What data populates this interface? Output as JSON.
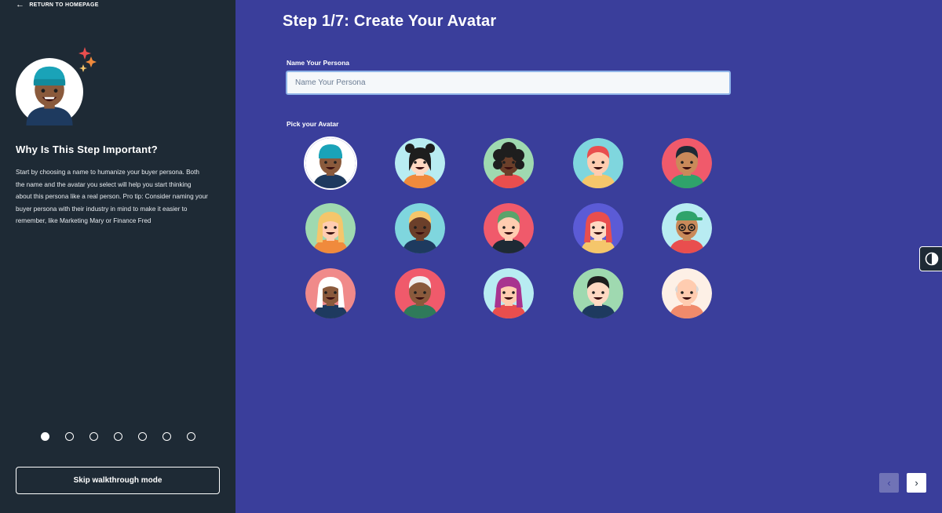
{
  "sidebar": {
    "return_label": "RETURN TO HOMEPAGE",
    "return_icon": "arrow-left-icon",
    "title": "Why Is This Step Important?",
    "description": "Start by choosing a name to humanize your buyer persona. Both the name and the avatar you select will help you start thinking about this persona like a real person. Pro tip: Consider naming your buyer persona with their industry in mind to make it easier to remember, like Marketing Mary or Finance Fred",
    "progress": {
      "current_step": 1,
      "total_steps": 7
    },
    "skip_label": "Skip walkthrough mode"
  },
  "main": {
    "step_title": "Step 1/7: Create Your Avatar",
    "name_label": "Name Your Persona",
    "name_placeholder": "Name Your Persona",
    "name_value": "",
    "pick_label": "Pick your Avatar",
    "selected_avatar": 1,
    "avatars": [
      {
        "id": 1,
        "bg": "#ffffff",
        "skin": "#8a5a3c",
        "hair": "#1aa3b8",
        "shirt": "#1e3a5f",
        "style": "beanie"
      },
      {
        "id": 2,
        "bg": "#b8ecf2",
        "skin": "#ffd9c2",
        "hair": "#1e1e1e",
        "shirt": "#f08a3c",
        "style": "buns"
      },
      {
        "id": 3,
        "bg": "#9fd9b0",
        "skin": "#6b3f2a",
        "hair": "#1e1e1e",
        "shirt": "#e94e4e",
        "style": "curly"
      },
      {
        "id": 4,
        "bg": "#7fd6de",
        "skin": "#ffccb0",
        "hair": "#e94e4e",
        "shirt": "#f5c66b",
        "style": "short"
      },
      {
        "id": 5,
        "bg": "#f05a6b",
        "skin": "#c98a5a",
        "hair": "#1e2a35",
        "shirt": "#2fa36b",
        "style": "short"
      },
      {
        "id": 6,
        "bg": "#9fd9b0",
        "skin": "#ffccb0",
        "hair": "#f5c66b",
        "shirt": "#f08a3c",
        "style": "long"
      },
      {
        "id": 7,
        "bg": "#7fd6de",
        "skin": "#6b3f2a",
        "hair": "#f5c66b",
        "shirt": "#1e3a5f",
        "style": "short"
      },
      {
        "id": 8,
        "bg": "#f05a6b",
        "skin": "#ffccb0",
        "hair": "#5aa36b",
        "shirt": "#1e2a35",
        "style": "short"
      },
      {
        "id": 9,
        "bg": "#5b5bd6",
        "skin": "#ffd9c2",
        "hair": "#e94e4e",
        "shirt": "#f5c66b",
        "style": "long"
      },
      {
        "id": 10,
        "bg": "#b8ecf2",
        "skin": "#c98a5a",
        "hair": "#2fa36b",
        "shirt": "#e94e4e",
        "style": "cap"
      },
      {
        "id": 11,
        "bg": "#f08a8a",
        "skin": "#8a5a3c",
        "hair": "#ffffff",
        "shirt": "#1e3a5f",
        "style": "long"
      },
      {
        "id": 12,
        "bg": "#f05a6b",
        "skin": "#8a5a3c",
        "hair": "#f0f0f0",
        "shirt": "#2f7a5a",
        "style": "short"
      },
      {
        "id": 13,
        "bg": "#b8ecf2",
        "skin": "#ffccb0",
        "hair": "#a8338f",
        "shirt": "#e94e4e",
        "style": "long"
      },
      {
        "id": 14,
        "bg": "#9fd9b0",
        "skin": "#ffd9c2",
        "hair": "#1e1e1e",
        "shirt": "#1e3a5f",
        "style": "short"
      },
      {
        "id": 15,
        "bg": "#fdf0e6",
        "skin": "#ffccb0",
        "hair": "#d9d9d9",
        "shirt": "#f08a6b",
        "style": "bald"
      }
    ]
  },
  "controls": {
    "contrast_icon": "contrast-icon",
    "prev_icon": "chevron-left-icon",
    "next_icon": "chevron-right-icon"
  },
  "colors": {
    "sidebar_bg": "#1e2a35",
    "main_bg": "#3a3e9b",
    "input_border": "#8fb4e8"
  }
}
